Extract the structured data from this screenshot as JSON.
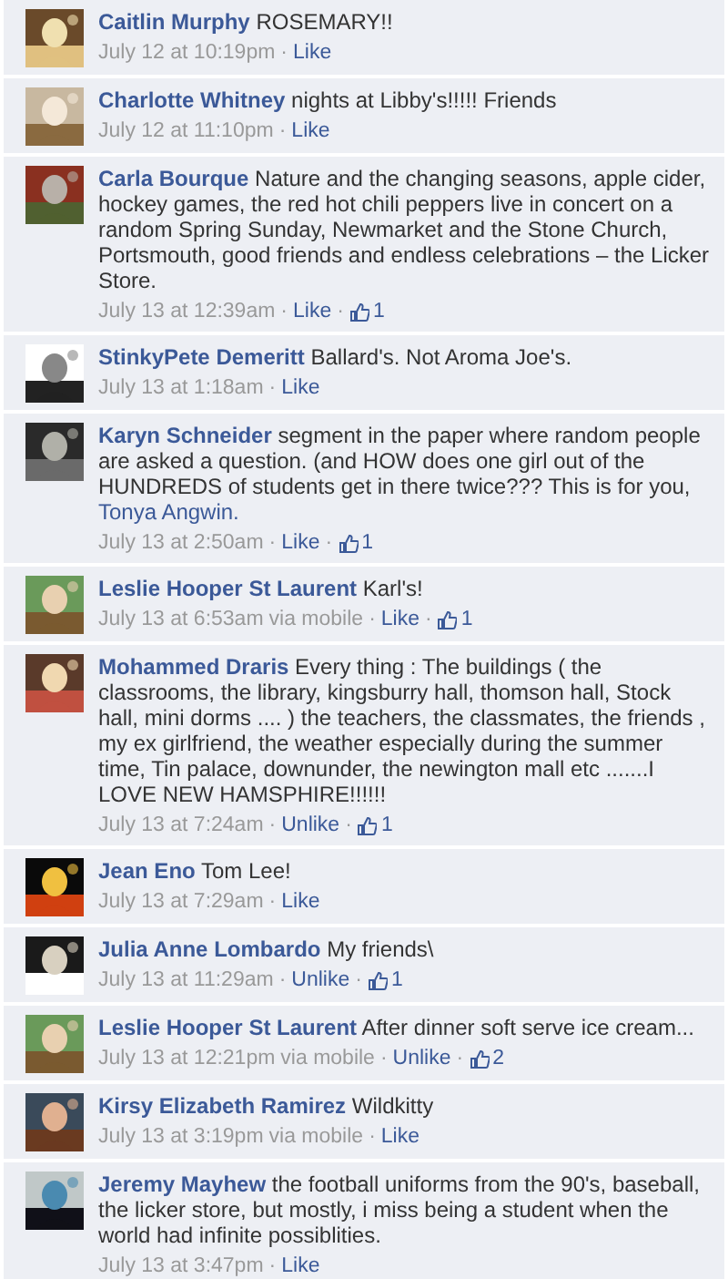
{
  "comments": [
    {
      "name": "Caitlin Murphy",
      "text": "ROSEMARY!!",
      "meta": [
        {
          "kind": "time",
          "text": "July 12 at 10:19pm"
        },
        {
          "kind": "sep",
          "text": "·"
        },
        {
          "kind": "action",
          "text": "Like"
        }
      ]
    },
    {
      "name": "Charlotte Whitney",
      "text": "nights at Libby's!!!!! Friends",
      "meta": [
        {
          "kind": "time",
          "text": "July 12 at 11:10pm"
        },
        {
          "kind": "sep",
          "text": "·"
        },
        {
          "kind": "action",
          "text": "Like"
        }
      ]
    },
    {
      "name": "Carla Bourque",
      "text": "Nature and the changing seasons, apple cider, hockey games, the red hot chili peppers live in concert on a random Spring Sunday, Newmarket and the Stone Church, Portsmouth, good friends and endless celebrations – the Licker Store.",
      "meta": [
        {
          "kind": "time",
          "text": "July 13 at 12:39am"
        },
        {
          "kind": "sep",
          "text": "·"
        },
        {
          "kind": "action",
          "text": "Like"
        },
        {
          "kind": "sep",
          "text": "·"
        },
        {
          "kind": "likes",
          "text": "1"
        }
      ]
    },
    {
      "name": "StinkyPete Demeritt",
      "text": "Ballard's. Not Aroma Joe's.",
      "meta": [
        {
          "kind": "time",
          "text": "July 13 at 1:18am"
        },
        {
          "kind": "sep",
          "text": "·"
        },
        {
          "kind": "action",
          "text": "Like"
        }
      ]
    },
    {
      "name": "Karyn Schneider",
      "text": "segment in the paper where random people are asked a question. (and HOW does one girl out of the HUNDREDS of students get in there twice??? This is for you,",
      "mention": "Tonya Angwin.",
      "meta": [
        {
          "kind": "time",
          "text": "July 13 at 2:50am"
        },
        {
          "kind": "sep",
          "text": "·"
        },
        {
          "kind": "action",
          "text": "Like"
        },
        {
          "kind": "sep",
          "text": "·"
        },
        {
          "kind": "likes",
          "text": "1"
        }
      ]
    },
    {
      "name": "Leslie Hooper St Laurent",
      "text": "Karl's!",
      "meta": [
        {
          "kind": "time",
          "text": "July 13 at 6:53am"
        },
        {
          "kind": "via",
          "text": "via mobile"
        },
        {
          "kind": "sep",
          "text": "·"
        },
        {
          "kind": "action",
          "text": "Like"
        },
        {
          "kind": "sep",
          "text": "·"
        },
        {
          "kind": "likes",
          "text": "1"
        }
      ]
    },
    {
      "name": "Mohammed Draris",
      "text": "Every thing : The buildings ( the classrooms, the library, kingsburry hall, thomson hall, Stock hall, mini dorms .... ) the teachers, the classmates, the friends , my ex girlfriend, the weather especially during the summer time, Tin palace, downunder, the newington mall etc .......I LOVE NEW HAMSPHIRE!!!!!!",
      "meta": [
        {
          "kind": "time",
          "text": "July 13 at 7:24am"
        },
        {
          "kind": "sep",
          "text": "·"
        },
        {
          "kind": "action",
          "text": "Unlike"
        },
        {
          "kind": "sep",
          "text": "·"
        },
        {
          "kind": "likes",
          "text": "1"
        }
      ]
    },
    {
      "name": "Jean Eno",
      "text": "Tom Lee!",
      "meta": [
        {
          "kind": "time",
          "text": "July 13 at 7:29am"
        },
        {
          "kind": "sep",
          "text": "·"
        },
        {
          "kind": "action",
          "text": "Like"
        }
      ]
    },
    {
      "name": "Julia Anne Lombardo",
      "text": "My friends\\",
      "meta": [
        {
          "kind": "time",
          "text": "July 13 at 11:29am"
        },
        {
          "kind": "sep",
          "text": "·"
        },
        {
          "kind": "action",
          "text": "Unlike"
        },
        {
          "kind": "sep",
          "text": "·"
        },
        {
          "kind": "likes",
          "text": "1"
        }
      ]
    },
    {
      "name": "Leslie Hooper St Laurent",
      "text": "After dinner soft serve ice cream...",
      "meta": [
        {
          "kind": "time",
          "text": "July 13 at 12:21pm"
        },
        {
          "kind": "via",
          "text": "via mobile"
        },
        {
          "kind": "sep",
          "text": "·"
        },
        {
          "kind": "action",
          "text": "Unlike"
        },
        {
          "kind": "sep",
          "text": "·"
        },
        {
          "kind": "likes",
          "text": "2"
        }
      ]
    },
    {
      "name": "Kirsy Elizabeth Ramirez",
      "text": "Wildkitty",
      "meta": [
        {
          "kind": "time",
          "text": "July 13 at 3:19pm"
        },
        {
          "kind": "via",
          "text": "via mobile"
        },
        {
          "kind": "sep",
          "text": "·"
        },
        {
          "kind": "action",
          "text": "Like"
        }
      ]
    },
    {
      "name": "Jeremy Mayhew",
      "text": "the football uniforms from the 90's, baseball, the licker store, but mostly, i miss being a student when the world had infinite possiblities.",
      "meta": [
        {
          "kind": "time",
          "text": "July 13 at 3:47pm"
        },
        {
          "kind": "sep",
          "text": "·"
        },
        {
          "kind": "action",
          "text": "Like"
        }
      ]
    }
  ]
}
